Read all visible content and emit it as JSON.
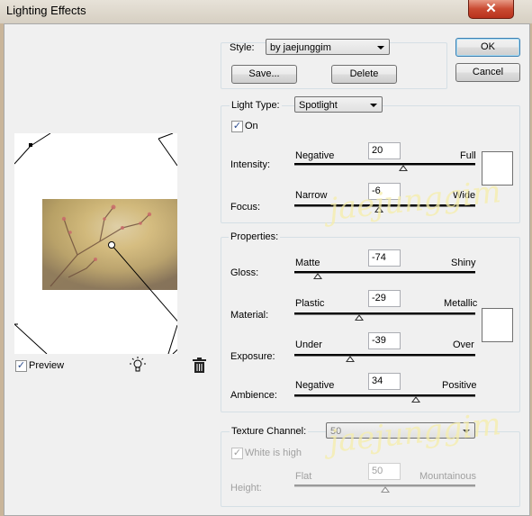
{
  "window": {
    "title": "Lighting Effects",
    "close_glyph": "✕"
  },
  "buttons": {
    "ok": "OK",
    "cancel": "Cancel",
    "save": "Save...",
    "delete": "Delete"
  },
  "style": {
    "label": "Style:",
    "value": "by jaejunggim"
  },
  "light_type": {
    "label": "Light Type:",
    "value": "Spotlight",
    "on_label": "On",
    "on_checked": true
  },
  "intensity": {
    "label": "Intensity:",
    "min_label": "Negative",
    "max_label": "Full",
    "value": "20",
    "level_pct": 60,
    "color": "#ffffff"
  },
  "focus": {
    "label": "Focus:",
    "min_label": "Narrow",
    "max_label": "Wide",
    "value": "-6",
    "level_pct": 47
  },
  "properties": {
    "title": "Properties:",
    "gloss": {
      "label": "Gloss:",
      "min_label": "Matte",
      "max_label": "Shiny",
      "value": "-74",
      "level_pct": 13
    },
    "material": {
      "label": "Material:",
      "min_label": "Plastic",
      "max_label": "Metallic",
      "value": "-29",
      "level_pct": 36
    },
    "exposure": {
      "label": "Exposure:",
      "min_label": "Under",
      "max_label": "Over",
      "value": "-39",
      "level_pct": 31
    },
    "ambience": {
      "label": "Ambience:",
      "min_label": "Negative",
      "max_label": "Positive",
      "value": "34",
      "level_pct": 67
    },
    "ambient_color": "#ffffff"
  },
  "texture": {
    "label": "Texture Channel:",
    "value": "50",
    "white_is_high_label": "White is high",
    "white_is_high_checked": true,
    "height_label": "Height:",
    "min_label": "Flat",
    "max_label": "Mountainous",
    "level_pct": 50
  },
  "preview": {
    "label": "Preview",
    "checked": true,
    "light_icon": "light-bulb-icon",
    "trash_icon": "trash-icon"
  },
  "watermark": "jaejunggim",
  "check_glyph": "✓"
}
